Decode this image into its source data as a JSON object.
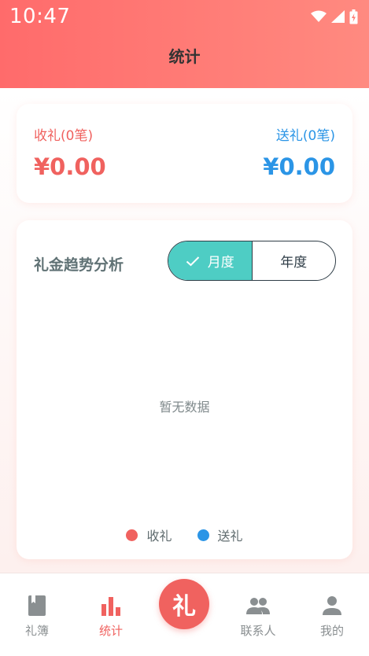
{
  "status": {
    "time": "10:47"
  },
  "header": {
    "title": "统计"
  },
  "summary": {
    "received_label": "收礼(0笔)",
    "received_amount": "¥0.00",
    "sent_label": "送礼(0笔)",
    "sent_amount": "¥0.00"
  },
  "trend": {
    "title": "礼金趋势分析",
    "toggle": {
      "monthly": "月度",
      "yearly": "年度",
      "selected": "monthly"
    },
    "empty_text": "暂无数据",
    "legend": [
      {
        "label": "收礼",
        "color": "#f0625f"
      },
      {
        "label": "送礼",
        "color": "#2b95e6"
      }
    ]
  },
  "tabbar": {
    "items": [
      {
        "label": "礼簿",
        "icon": "book-icon"
      },
      {
        "label": "统计",
        "icon": "bar-chart-icon",
        "active": true
      },
      {
        "label": "联系人",
        "icon": "contacts-icon"
      },
      {
        "label": "我的",
        "icon": "person-icon"
      }
    ],
    "center": {
      "label": "礼"
    }
  },
  "colors": {
    "accent": "#f0625f",
    "blue": "#2b95e6",
    "teal": "#4ecdc4"
  }
}
